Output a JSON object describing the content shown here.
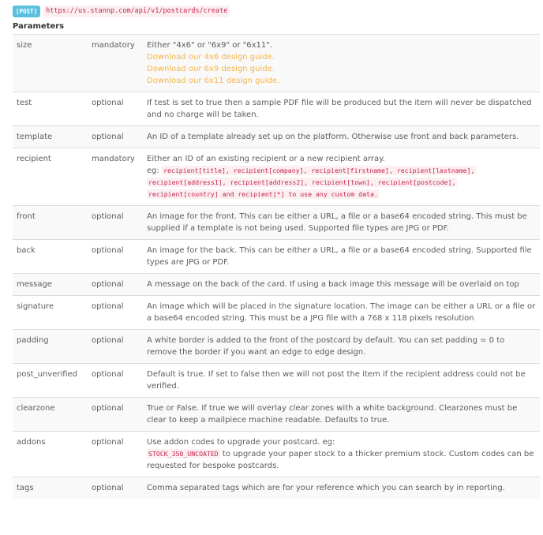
{
  "endpoint": {
    "method": "[POST]",
    "url": "https://us.stannp.com/api/v1/postcards/create"
  },
  "section_title": "Parameters",
  "params": [
    {
      "name": "size",
      "requirement": "mandatory",
      "description": "Either \"4x6\" or \"6x9\" or \"6x11\".",
      "links": [
        "Download our 4x6 design guide.",
        "Download our 6x9 design guide.",
        "Download our 6x11 design guide."
      ]
    },
    {
      "name": "test",
      "requirement": "optional",
      "description": "If test is set to true then a sample PDF file will be produced but the item will never be dispatched and no charge will be taken."
    },
    {
      "name": "template",
      "requirement": "optional",
      "description": "An ID of a template already set up on the platform. Otherwise use front and back parameters."
    },
    {
      "name": "recipient",
      "requirement": "mandatory",
      "description": "Either an ID of an existing recipient or a new recipient array.",
      "example_prefix": "eg:",
      "code_lines": [
        "recipient[title], recipient[company], recipient[firstname], recipient[lastname],",
        "recipient[address1], recipient[address2], recipient[town], recipient[postcode],",
        "recipient[country] and recipient[*] to use any custom data."
      ]
    },
    {
      "name": "front",
      "requirement": "optional",
      "description": "An image for the front. This can be either a URL, a file or a base64 encoded string. This must be supplied if a template is not being used. Supported file types are JPG or PDF."
    },
    {
      "name": "back",
      "requirement": "optional",
      "description": "An image for the back. This can be either a URL, a file or a base64 encoded string. Supported file types are JPG or PDF."
    },
    {
      "name": "message",
      "requirement": "optional",
      "description": "A message on the back of the card. If using a back image this message will be overlaid on top"
    },
    {
      "name": "signature",
      "requirement": "optional",
      "description": "An image which will be placed in the signature location. The image can be either a URL or a file or a base64 encoded string. This must be a JPG file with a 768 x 118 pixels resolution"
    },
    {
      "name": "padding",
      "requirement": "optional",
      "description": "A white border is added to the front of the postcard by default. You can set padding = 0 to remove the border if you want an edge to edge design."
    },
    {
      "name": "post_unverified",
      "requirement": "optional",
      "description": "Default is true. If set to false then we will not post the item if the recipient address could not be verified."
    },
    {
      "name": "clearzone",
      "requirement": "optional",
      "description": "True or False. If true we will overlay clear zones with a white background. Clearzones must be clear to keep a mailpiece machine readable. Defaults to true."
    },
    {
      "name": "addons",
      "requirement": "optional",
      "description": "Use addon codes to upgrade your postcard. eg:",
      "code": "STOCK_350_UNCOATED",
      "description_after": " to upgrade your paper stock to a thicker premium stock. Custom codes can be requested for bespoke postcards."
    },
    {
      "name": "tags",
      "requirement": "optional",
      "description": "Comma separated tags which are for your reference which you can search by in reporting."
    }
  ]
}
